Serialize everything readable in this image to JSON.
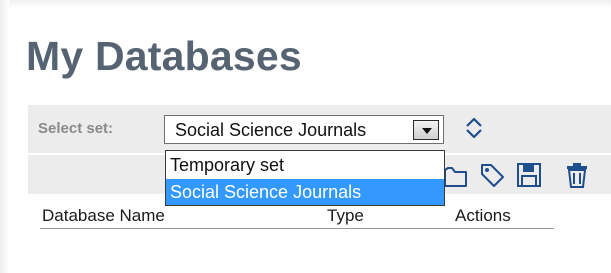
{
  "page": {
    "title": "My Databases"
  },
  "set_selector": {
    "label": "Select set:",
    "selected_value": "Social Science Journals",
    "options": [
      "Temporary set",
      "Social Science Journals"
    ],
    "highlighted_option_index": 1
  },
  "toolbar_icons": [
    "sort-arrows-icon",
    "folder-icon",
    "tag-icon",
    "save-icon",
    "delete-icon"
  ],
  "table": {
    "columns": [
      "Database Name",
      "Type",
      "Actions"
    ]
  },
  "colors": {
    "title": "#566372",
    "toolbar_bg": "#ececec",
    "highlight": "#3399ff",
    "icon_blue": "#1f4e8c"
  }
}
